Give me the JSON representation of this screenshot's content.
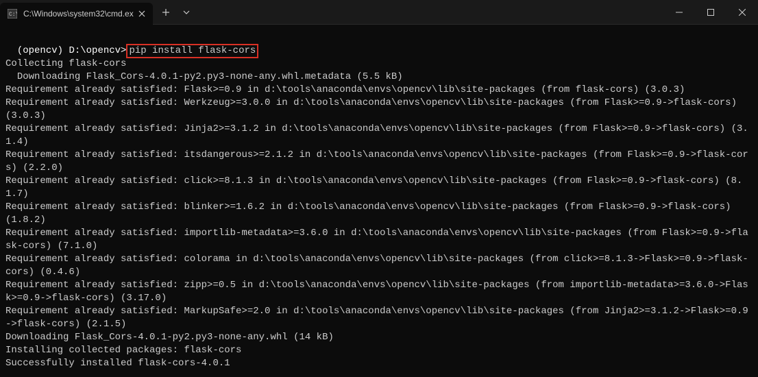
{
  "titlebar": {
    "tab_title": "C:\\Windows\\system32\\cmd.ex",
    "tab_icon_name": "cmd-icon",
    "close_label": "×",
    "new_tab_label": "+",
    "dropdown_label": "⌄"
  },
  "terminal": {
    "prompt_env": "(opencv)",
    "prompt_path": "D:\\opencv>",
    "command": "pip install flask-cors",
    "output_lines": [
      "Collecting flask-cors",
      "  Downloading Flask_Cors-4.0.1-py2.py3-none-any.whl.metadata (5.5 kB)",
      "Requirement already satisfied: Flask>=0.9 in d:\\tools\\anaconda\\envs\\opencv\\lib\\site-packages (from flask-cors) (3.0.3)",
      "Requirement already satisfied: Werkzeug>=3.0.0 in d:\\tools\\anaconda\\envs\\opencv\\lib\\site-packages (from Flask>=0.9->flask-cors) (3.0.3)",
      "Requirement already satisfied: Jinja2>=3.1.2 in d:\\tools\\anaconda\\envs\\opencv\\lib\\site-packages (from Flask>=0.9->flask-cors) (3.1.4)",
      "Requirement already satisfied: itsdangerous>=2.1.2 in d:\\tools\\anaconda\\envs\\opencv\\lib\\site-packages (from Flask>=0.9->flask-cors) (2.2.0)",
      "Requirement already satisfied: click>=8.1.3 in d:\\tools\\anaconda\\envs\\opencv\\lib\\site-packages (from Flask>=0.9->flask-cors) (8.1.7)",
      "Requirement already satisfied: blinker>=1.6.2 in d:\\tools\\anaconda\\envs\\opencv\\lib\\site-packages (from Flask>=0.9->flask-cors) (1.8.2)",
      "Requirement already satisfied: importlib-metadata>=3.6.0 in d:\\tools\\anaconda\\envs\\opencv\\lib\\site-packages (from Flask>=0.9->flask-cors) (7.1.0)",
      "Requirement already satisfied: colorama in d:\\tools\\anaconda\\envs\\opencv\\lib\\site-packages (from click>=8.1.3->Flask>=0.9->flask-cors) (0.4.6)",
      "Requirement already satisfied: zipp>=0.5 in d:\\tools\\anaconda\\envs\\opencv\\lib\\site-packages (from importlib-metadata>=3.6.0->Flask>=0.9->flask-cors) (3.17.0)",
      "Requirement already satisfied: MarkupSafe>=2.0 in d:\\tools\\anaconda\\envs\\opencv\\lib\\site-packages (from Jinja2>=3.1.2->Flask>=0.9->flask-cors) (2.1.5)",
      "Downloading Flask_Cors-4.0.1-py2.py3-none-any.whl (14 kB)",
      "Installing collected packages: flask-cors",
      "Successfully installed flask-cors-4.0.1"
    ]
  }
}
